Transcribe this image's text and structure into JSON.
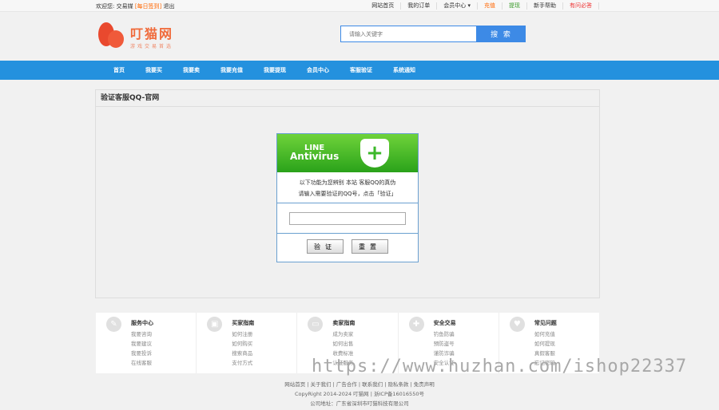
{
  "topbar": {
    "welcome": "欢迎您:",
    "user": "交易媒",
    "signin": "[每日签到]",
    "logout": "退出",
    "links": [
      {
        "label": "网站首页",
        "color": "#333"
      },
      {
        "label": "我的订单",
        "color": "#333"
      },
      {
        "label": "会员中心 ▾",
        "color": "#333"
      },
      {
        "label": "充值",
        "color": "#f60"
      },
      {
        "label": "提现",
        "color": "#3a9a2a"
      },
      {
        "label": "新手帮助",
        "color": "#333"
      },
      {
        "label": "有问必答",
        "color": "#e33"
      }
    ]
  },
  "logo": {
    "name": "叮猫网",
    "slogan": "游戏交易首选"
  },
  "search": {
    "placeholder": "请输入关键字",
    "button": "搜 索"
  },
  "nav": [
    "首页",
    "我要买",
    "我要卖",
    "我要充值",
    "我要提现",
    "会员中心",
    "客服验证",
    "系统通知"
  ],
  "panel": {
    "title": "验证客服QQ-官网",
    "banner": {
      "line1": "LINE",
      "line2": "Antivirus"
    },
    "desc1": "以下功能为您辨别 本站 客服QQ的真伪",
    "desc2": "请输入需要验证的QQ号，点击「验证」",
    "input_value": "",
    "verify": "验证",
    "reset": "重置"
  },
  "footer": [
    {
      "title": "服务中心",
      "icon": "compass-icon",
      "glyph": "✎",
      "links": [
        "我要咨询",
        "我要建议",
        "我要投诉",
        "在线客服"
      ]
    },
    {
      "title": "买家指南",
      "icon": "bus-icon",
      "glyph": "▣",
      "links": [
        "如何注册",
        "如何购买",
        "搜索商品",
        "支付方式"
      ]
    },
    {
      "title": "卖家指南",
      "icon": "wallet-icon",
      "glyph": "▭",
      "links": [
        "成为卖家",
        "如何出售",
        "收费标准",
        "认证服务"
      ]
    },
    {
      "title": "安全交易",
      "icon": "wrench-icon",
      "glyph": "✚",
      "links": [
        "钓鱼防骗",
        "预防盗号",
        "谨防诈骗",
        "安全认证"
      ]
    },
    {
      "title": "常见问题",
      "icon": "heart-icon",
      "glyph": "♥",
      "links": [
        "如何充值",
        "如何提现",
        "真假客服",
        "忘记密码"
      ]
    }
  ],
  "bottom": {
    "links": "网站首页 | 关于我们 | 广告合作 | 联系我们 | 隐私条款 | 免责声明",
    "copyright": "CopyRight 2014-2024 叮猫网 | 浙ICP备16016550号",
    "address": "公司地址：广东省深圳市叮猫科技有限公司"
  },
  "watermark": "https://www.huzhan.com/ishop22337"
}
